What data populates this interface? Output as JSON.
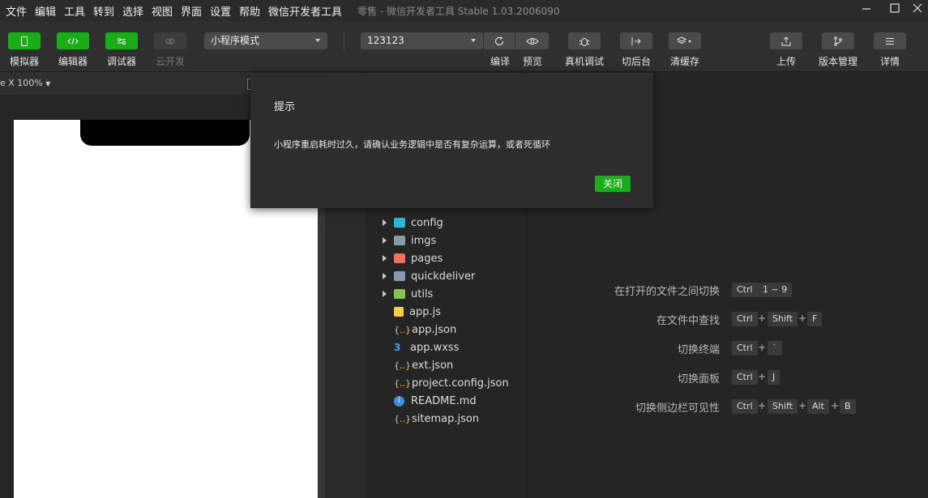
{
  "menu": [
    "文件",
    "编辑",
    "工具",
    "转到",
    "选择",
    "视图",
    "界面",
    "设置",
    "帮助",
    "微信开发者工具"
  ],
  "app_title": "零售 - 微信开发者工具 Stable 1.03.2006090",
  "toolbar": {
    "simulator": "模拟器",
    "editor": "编辑器",
    "debugger": "调试器",
    "cloud": "云开发",
    "mode_select": "小程序模式",
    "compile_select": "123123",
    "compile": "编译",
    "preview": "预览",
    "remote_debug": "真机调试",
    "background": "切后台",
    "clear_cache": "清缓存",
    "upload": "上传",
    "version": "版本管理",
    "details": "详情"
  },
  "zoom": "e X 100%",
  "tree": [
    {
      "name": "config",
      "type": "folder",
      "icon": "folder-config-icon",
      "color": "#2fb5d6"
    },
    {
      "name": "imgs",
      "type": "folder",
      "icon": "folder-icon",
      "color": "#8a9aaa"
    },
    {
      "name": "pages",
      "type": "folder",
      "icon": "folder-pages-icon",
      "color": "#f0705a"
    },
    {
      "name": "quickdeliver",
      "type": "folder",
      "icon": "folder-icon",
      "color": "#8a9aaa"
    },
    {
      "name": "utils",
      "type": "folder",
      "icon": "folder-utils-icon",
      "color": "#8cc152"
    },
    {
      "name": "app.js",
      "type": "file",
      "icon": "js-icon",
      "color": "#f5d142"
    },
    {
      "name": "app.json",
      "type": "file",
      "icon": "json-icon",
      "color": "#f5c242"
    },
    {
      "name": "app.wxss",
      "type": "file",
      "icon": "css-icon",
      "color": "#42a5f5"
    },
    {
      "name": "ext.json",
      "type": "file",
      "icon": "json-icon",
      "color": "#f5c242"
    },
    {
      "name": "project.config.json",
      "type": "file",
      "icon": "json-icon",
      "color": "#f5c242"
    },
    {
      "name": "README.md",
      "type": "file",
      "icon": "info-icon",
      "color": "#3d8fe8"
    },
    {
      "name": "sitemap.json",
      "type": "file",
      "icon": "json-icon",
      "color": "#f5c242"
    }
  ],
  "shortcuts": [
    {
      "label": "在打开的文件之间切换",
      "keys": [
        "Ctrl",
        "1 ~ 9"
      ]
    },
    {
      "label": "在文件中查找",
      "keys": [
        "Ctrl",
        "Shift",
        "F"
      ]
    },
    {
      "label": "切换终端",
      "keys": [
        "Ctrl",
        "`"
      ]
    },
    {
      "label": "切换面板",
      "keys": [
        "Ctrl",
        "J"
      ]
    },
    {
      "label": "切换侧边栏可见性",
      "keys": [
        "Ctrl",
        "Shift",
        "Alt",
        "B"
      ]
    }
  ],
  "shortcut_plus": "+",
  "dialog": {
    "title": "提示",
    "message": "小程序重启耗时过久，请确认业务逻辑中是否有复杂运算，或者死循环",
    "close": "关闭"
  },
  "colors": {
    "accent": "#1aad19",
    "background": "#2b2b2b"
  }
}
